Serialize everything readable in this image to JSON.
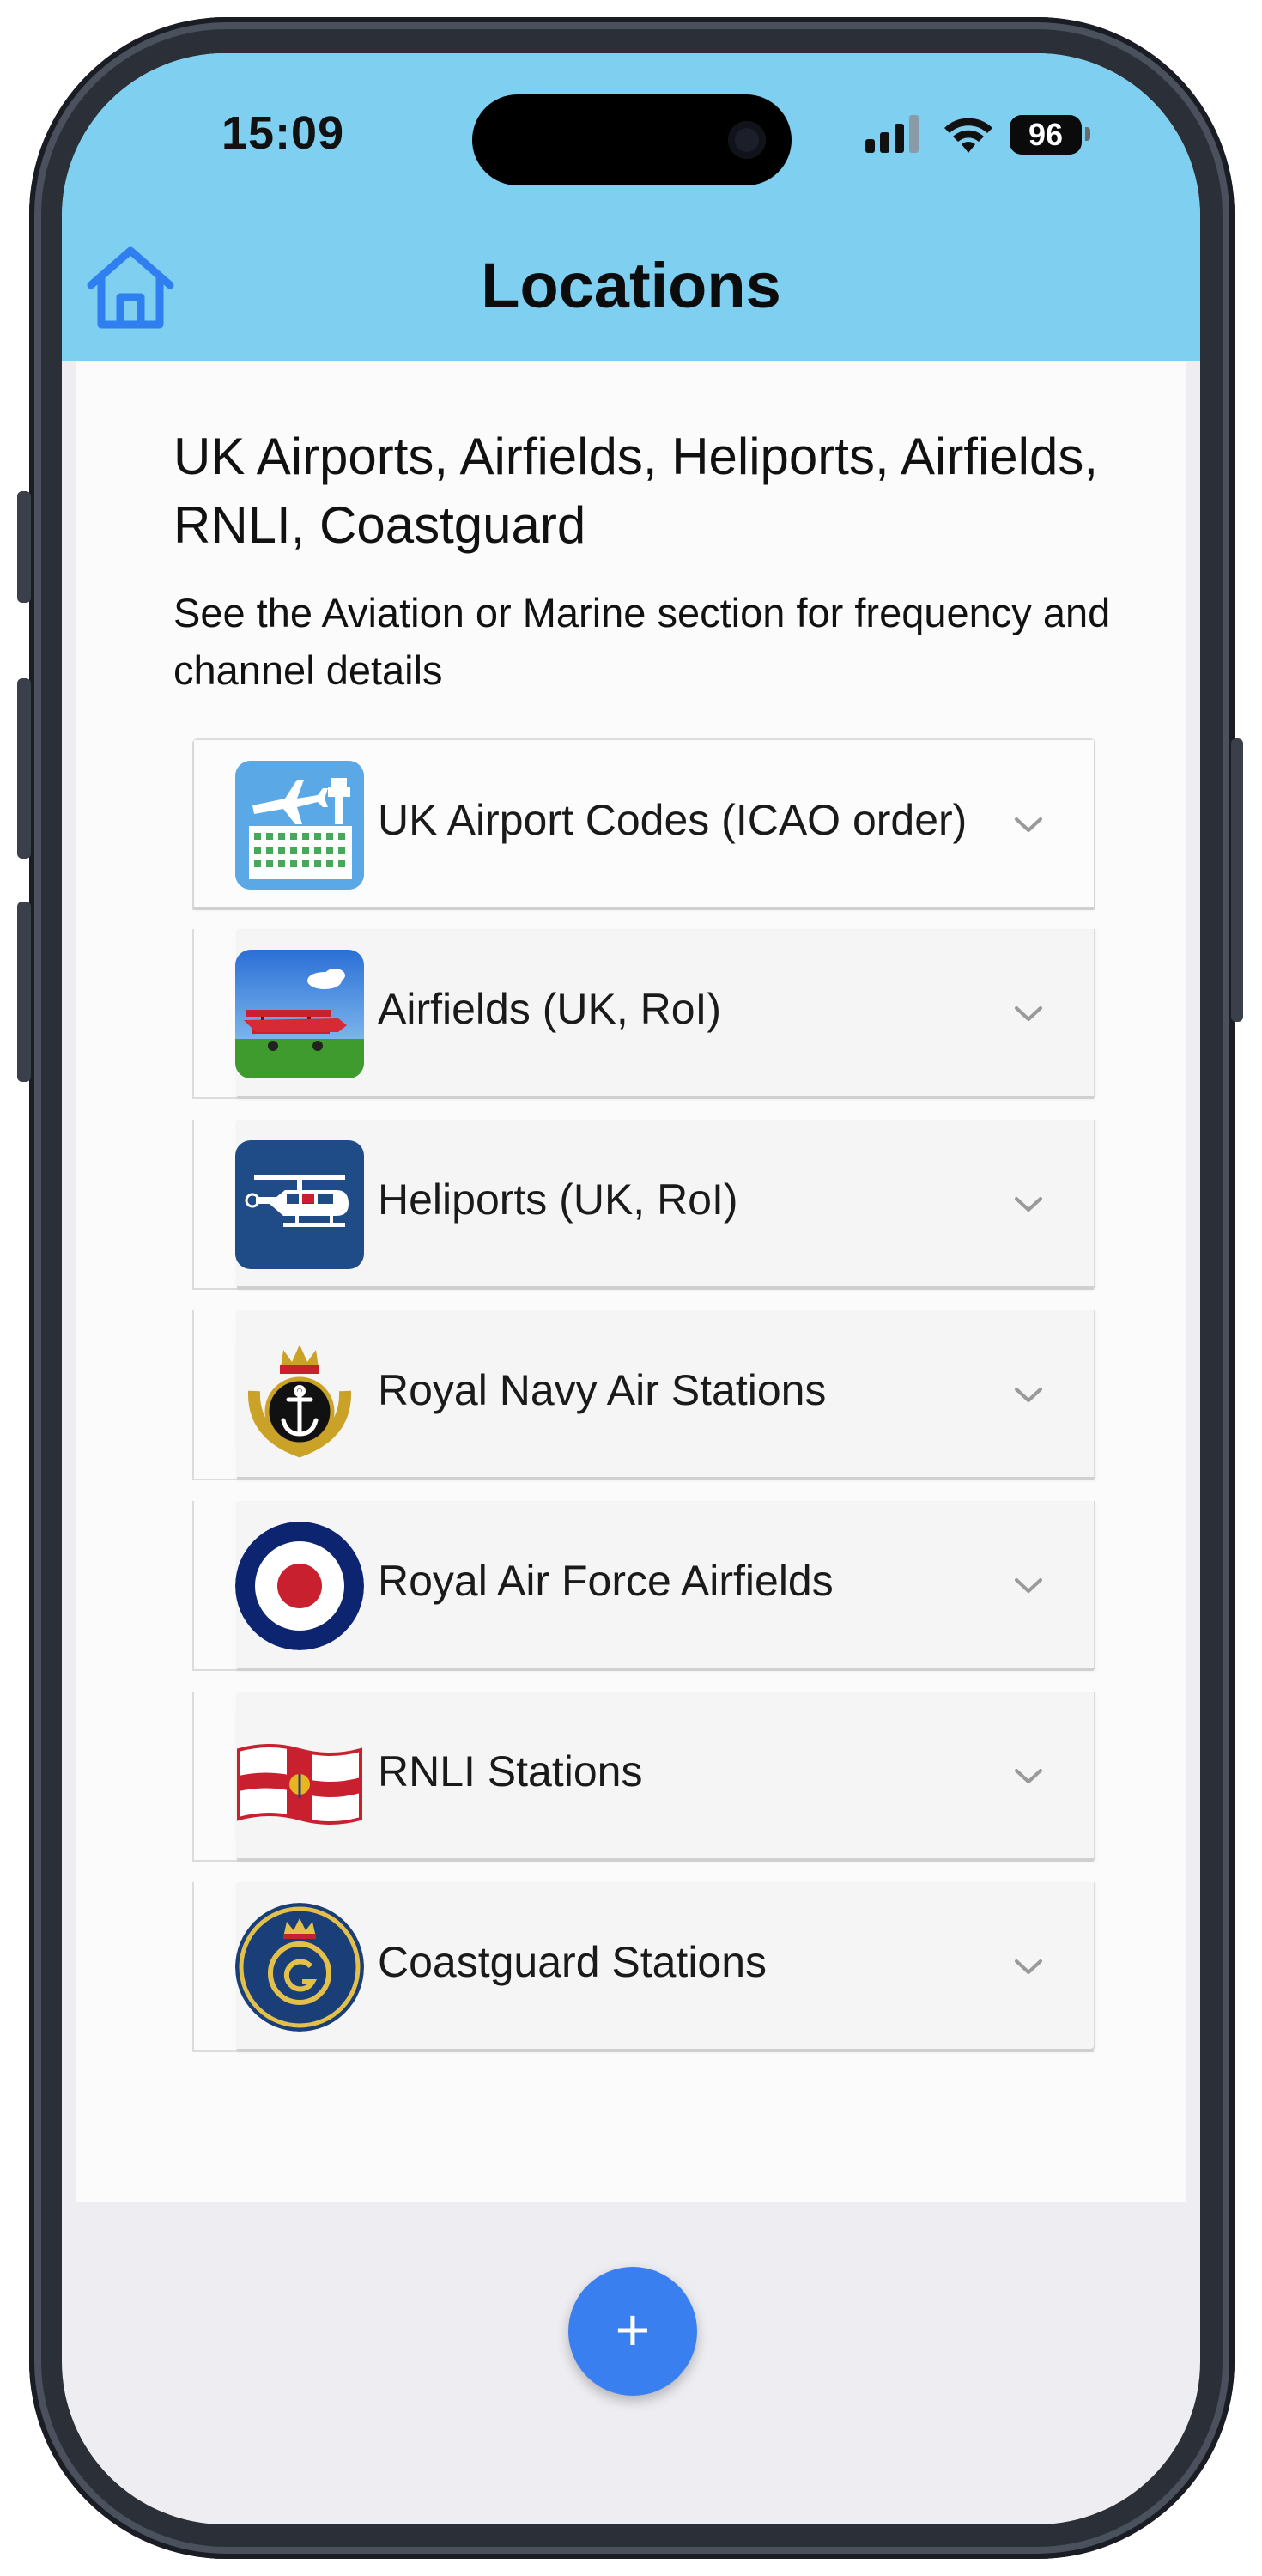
{
  "status": {
    "time": "15:09",
    "battery": "96"
  },
  "nav": {
    "title": "Locations",
    "home_icon": "home-icon"
  },
  "content": {
    "heading": "UK Airports, Airfields, Heliports, Airfields, RNLI, Coastguard",
    "subheading": "See the Aviation or Marine section for frequency and channel details"
  },
  "items": [
    {
      "label": "UK Airport Codes (ICAO order)",
      "icon": "airport-tower-icon"
    },
    {
      "label": "Airfields (UK, RoI)",
      "icon": "biplane-icon"
    },
    {
      "label": "Heliports (UK, RoI)",
      "icon": "helicopter-icon"
    },
    {
      "label": "Royal Navy Air Stations",
      "icon": "royal-navy-crest-icon"
    },
    {
      "label": "Royal Air Force Airfields",
      "icon": "raf-roundel-icon"
    },
    {
      "label": "RNLI Stations",
      "icon": "rnli-flag-icon"
    },
    {
      "label": "Coastguard Stations",
      "icon": "hm-coastguard-badge-icon"
    }
  ],
  "fab": {
    "label": "+"
  },
  "colors": {
    "header": "#7ecff0",
    "accent": "#3a7ff0",
    "raf_blue": "#0d2570",
    "raf_red": "#c8202e"
  }
}
